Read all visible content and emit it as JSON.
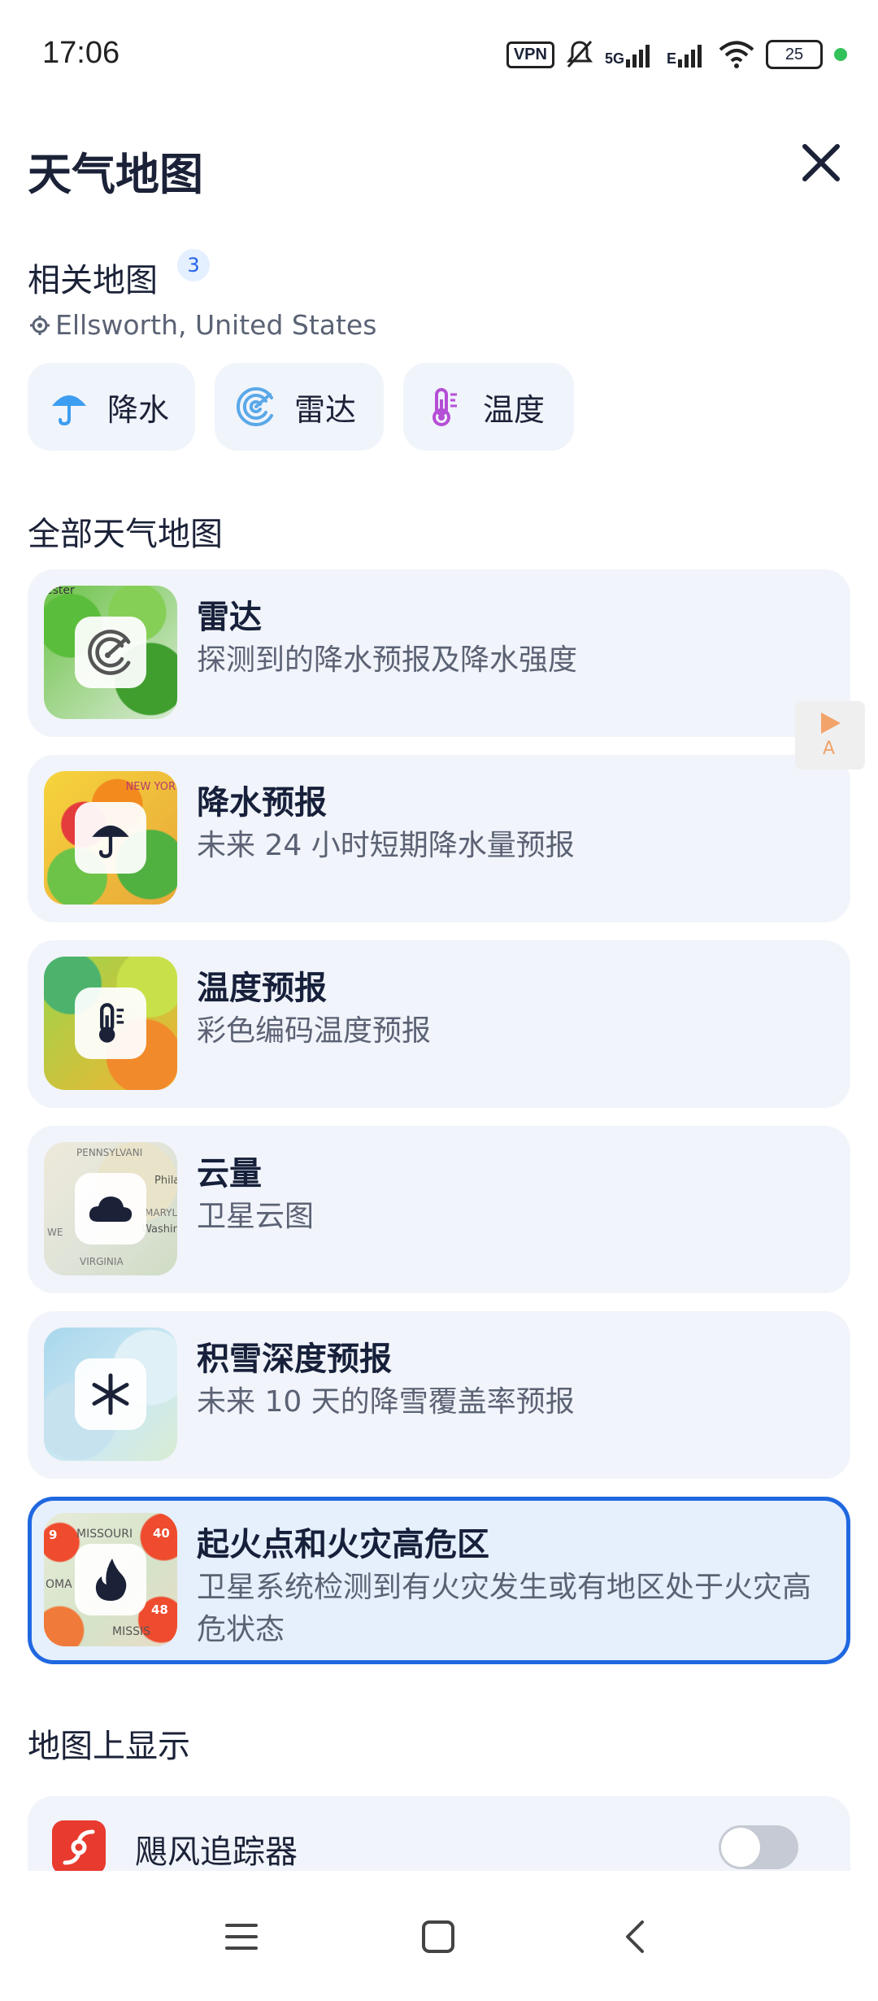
{
  "status_bar": {
    "time": "17:06",
    "vpn": "VPN",
    "net1": "5G",
    "net2": "E",
    "battery": "25",
    "icons": [
      "vpn-icon",
      "mute-icon",
      "signal-icon",
      "signal-icon",
      "wifi-icon",
      "battery-icon"
    ]
  },
  "header": {
    "title": "天气地图",
    "close_icon": "close-icon"
  },
  "related": {
    "title": "相关地图",
    "count": "3",
    "location": "Ellsworth, United States",
    "chips": [
      {
        "label": "降水",
        "icon": "umbrella-icon",
        "color": "#3d9df0"
      },
      {
        "label": "雷达",
        "icon": "radar-icon",
        "color": "#5aa8e8"
      },
      {
        "label": "温度",
        "icon": "thermometer-icon",
        "color": "#b54fd6"
      }
    ]
  },
  "all_maps": {
    "title": "全部天气地图",
    "items": [
      {
        "title": "雷达",
        "desc": "探测到的降水预报及降水强度",
        "icon": "radar-icon",
        "thumb_label": "ester"
      },
      {
        "title": "降水预报",
        "desc": "未来 24 小时短期降水量预报",
        "icon": "umbrella-icon",
        "thumb_label": "NEW YOR"
      },
      {
        "title": "温度预报",
        "desc": "彩色编码温度预报",
        "icon": "thermometer-icon"
      },
      {
        "title": "云量",
        "desc": "卫星云图",
        "icon": "cloud-icon",
        "thumb_labels": [
          "PENNSYLVANI",
          "Phila",
          "MARYLA",
          "Washing",
          "VIRGINIA",
          "WE"
        ]
      },
      {
        "title": "积雪深度预报",
        "desc": "未来 10 天的降雪覆盖率预报",
        "icon": "snowflake-icon"
      },
      {
        "title": "起火点和火灾高危区",
        "desc": "卫星系统检测到有火灾发生或有地区处于火灾高危状态",
        "icon": "flame-icon",
        "selected": true,
        "thumb_labels": [
          "MISSOURI",
          "OMA",
          "MISSIS",
          "40",
          "48",
          "9"
        ]
      }
    ]
  },
  "overlays": {
    "title": "地图上显示",
    "items": [
      {
        "label": "飓风追踪器",
        "icon": "hurricane-icon",
        "enabled": false
      }
    ]
  },
  "float_button": {
    "label": "A",
    "icon": "play-icon"
  },
  "nav": {
    "icons": [
      "menu-icon",
      "home-icon",
      "back-icon"
    ]
  },
  "colors": {
    "accent": "#1f68e0",
    "card_bg": "#f1f4fa",
    "text": "#1b2238",
    "muted": "#5b6274"
  }
}
